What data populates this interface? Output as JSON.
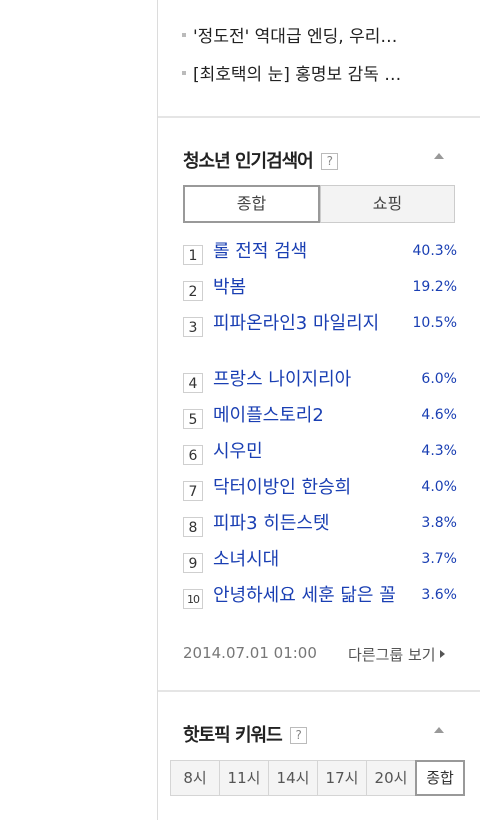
{
  "news": {
    "items": [
      "",
      "'정도전' 역대급 엔딩, 우리…",
      "[최호택의 눈] 홍명보 감독 …"
    ]
  },
  "teen_search": {
    "title": "청소년 인기검색어",
    "help": "?",
    "tabs": [
      {
        "label": "종합",
        "active": true
      },
      {
        "label": "쇼핑",
        "active": false
      }
    ],
    "ranks": [
      {
        "num": "1",
        "term": "롤 전적 검색",
        "pct": "40.3%"
      },
      {
        "num": "2",
        "term": "박봄",
        "pct": "19.2%"
      },
      {
        "num": "3",
        "term": "피파온라인3 마일리지",
        "pct": "10.5%"
      },
      {
        "num": "4",
        "term": "프랑스 나이지리아",
        "pct": "6.0%"
      },
      {
        "num": "5",
        "term": "메이플스토리2",
        "pct": "4.6%"
      },
      {
        "num": "6",
        "term": "시우민",
        "pct": "4.3%"
      },
      {
        "num": "7",
        "term": "닥터이방인 한승희",
        "pct": "4.0%"
      },
      {
        "num": "8",
        "term": "피파3 히든스텟",
        "pct": "3.8%"
      },
      {
        "num": "9",
        "term": "소녀시대",
        "pct": "3.7%"
      },
      {
        "num": "10",
        "term": "안녕하세요 세훈 닮은 꼴",
        "pct": "3.6%"
      }
    ],
    "timestamp": "2014.07.01 01:00",
    "other_group": "다른그룹 보기"
  },
  "hot_topic": {
    "title": "핫토픽 키워드",
    "help": "?",
    "hours": [
      {
        "label": "8시",
        "active": false
      },
      {
        "label": "11시",
        "active": false
      },
      {
        "label": "14시",
        "active": false
      },
      {
        "label": "17시",
        "active": false
      },
      {
        "label": "20시",
        "active": false
      },
      {
        "label": "종합",
        "active": true
      }
    ]
  }
}
